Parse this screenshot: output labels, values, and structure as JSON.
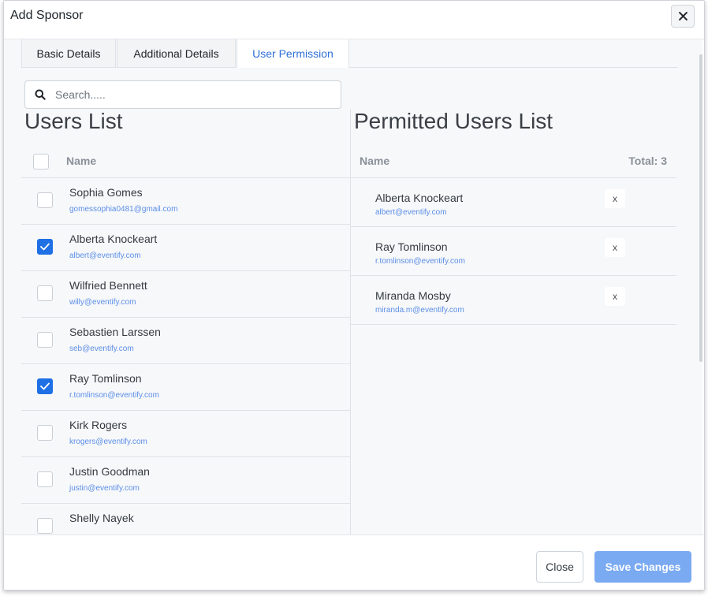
{
  "modal": {
    "title": "Add Sponsor",
    "close_icon": "close-icon"
  },
  "tabs": [
    {
      "label": "Basic Details",
      "active": false
    },
    {
      "label": "Additional Details",
      "active": false
    },
    {
      "label": "User Permission",
      "active": true
    }
  ],
  "search": {
    "placeholder": "Search.....",
    "value": "",
    "icon": "search-icon"
  },
  "users_list": {
    "title": "Users List",
    "name_header": "Name",
    "users": [
      {
        "name": "Sophia Gomes",
        "email": "gomessophia0481@gmail.com",
        "checked": false
      },
      {
        "name": "Alberta Knockeart",
        "email": "albert@eventify.com",
        "checked": true
      },
      {
        "name": "Wilfried Bennett",
        "email": "willy@eventify.com",
        "checked": false
      },
      {
        "name": "Sebastien Larssen",
        "email": "seb@eventify.com",
        "checked": false
      },
      {
        "name": "Ray Tomlinson",
        "email": "r.tomlinson@eventify.com",
        "checked": true
      },
      {
        "name": "Kirk Rogers",
        "email": "krogers@eventify.com",
        "checked": false
      },
      {
        "name": "Justin Goodman",
        "email": "justin@eventify.com",
        "checked": false
      },
      {
        "name": "Shelly Nayek",
        "email": "",
        "checked": false
      }
    ]
  },
  "permitted_list": {
    "title": "Permitted Users List",
    "name_header": "Name",
    "total_label": "Total: 3",
    "users": [
      {
        "name": "Alberta Knockeart",
        "email": "albert@eventify.com",
        "remove_label": "x"
      },
      {
        "name": "Ray Tomlinson",
        "email": "r.tomlinson@eventify.com",
        "remove_label": "x"
      },
      {
        "name": "Miranda Mosby",
        "email": "miranda.m@eventify.com",
        "remove_label": "x"
      }
    ]
  },
  "footer": {
    "close_label": "Close",
    "save_label": "Save Changes"
  },
  "colors": {
    "accent": "#1f6fe5",
    "active_tab": "#2f6fd6",
    "save_button": "#7aaaf2",
    "email_link": "#5b8ee6"
  }
}
